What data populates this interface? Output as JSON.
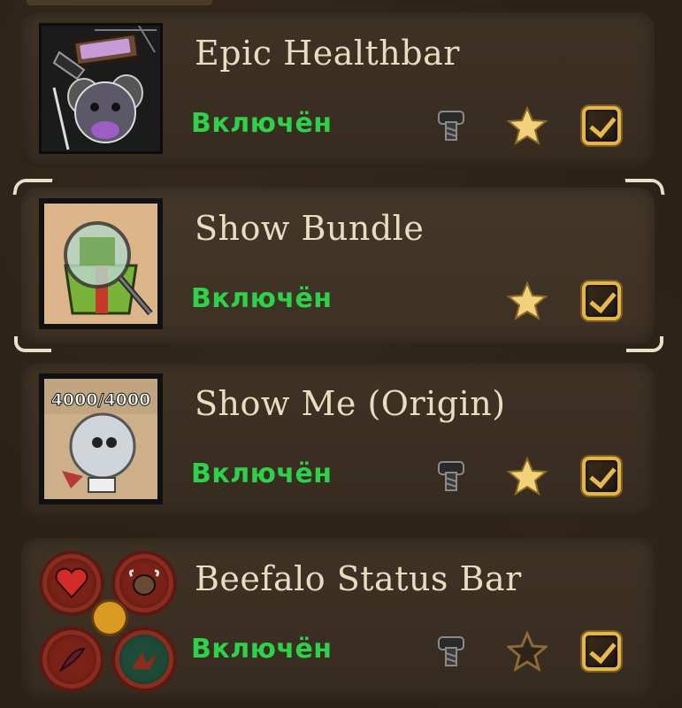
{
  "mods": [
    {
      "title": "Epic Healthbar",
      "status": "Включён",
      "icons": [
        "bolt-icon",
        "star-icon",
        "checkbox-checked-icon"
      ],
      "favorite": true,
      "enabled": true,
      "selected": false
    },
    {
      "title": "Show Bundle",
      "status": "Включён",
      "icons": [
        "star-icon",
        "checkbox-checked-icon"
      ],
      "favorite": true,
      "enabled": true,
      "selected": true
    },
    {
      "title": "Show Me (Origin)",
      "status": "Включён",
      "thumb_text": "4000/4000",
      "icons": [
        "bolt-icon",
        "star-icon",
        "checkbox-checked-icon"
      ],
      "favorite": true,
      "enabled": true,
      "selected": false
    },
    {
      "title": "Beefalo Status Bar",
      "status": "Включён",
      "icons": [
        "bolt-icon",
        "star-outline-icon",
        "checkbox-checked-icon"
      ],
      "favorite": false,
      "enabled": true,
      "selected": false
    }
  ],
  "colors": {
    "status_green": "#2fd14a",
    "title_cream": "#e9dcc0",
    "star_gold": "#f1d27a",
    "checkbox_gold": "#e2b64a",
    "row_bg": "#3a2f22"
  }
}
